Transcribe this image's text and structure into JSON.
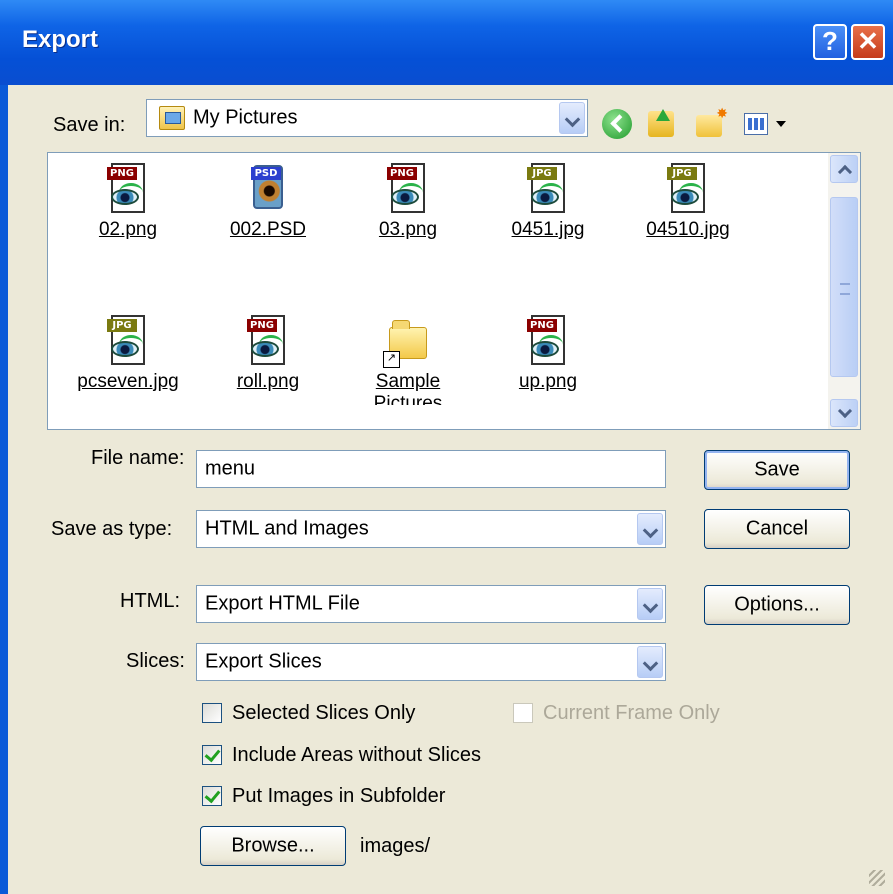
{
  "window": {
    "title": "Export",
    "help_icon": "?",
    "close_icon": "✕"
  },
  "save_in": {
    "label": "Save in:",
    "value": "My Pictures",
    "icon": "my-pictures-folder-icon"
  },
  "toolbar": {
    "icons": [
      "back-icon",
      "up-one-level-icon",
      "create-new-folder-icon",
      "views-menu-icon"
    ]
  },
  "files": [
    {
      "name": "02.png",
      "badge": "PNG",
      "type": "png"
    },
    {
      "name": "002.PSD",
      "badge": "PSD",
      "type": "psd"
    },
    {
      "name": "03.png",
      "badge": "PNG",
      "type": "png"
    },
    {
      "name": "0451.jpg",
      "badge": "JPG",
      "type": "jpg"
    },
    {
      "name": "04510.jpg",
      "badge": "JPG",
      "type": "jpg"
    },
    {
      "name": "pcseven.jpg",
      "badge": "JPG",
      "type": "jpg"
    },
    {
      "name": "roll.png",
      "badge": "PNG",
      "type": "png"
    },
    {
      "name": "Sample Pictures",
      "badge": "",
      "type": "folder-shortcut"
    },
    {
      "name": "up.png",
      "badge": "PNG",
      "type": "png"
    }
  ],
  "form": {
    "file_name_label": "File name:",
    "file_name_value": "menu",
    "save_as_type_label": "Save as type:",
    "save_as_type_value": "HTML and Images",
    "html_label": "HTML:",
    "html_value": "Export HTML File",
    "slices_label": "Slices:",
    "slices_value": "Export Slices"
  },
  "buttons": {
    "save": "Save",
    "cancel": "Cancel",
    "options": "Options...",
    "browse": "Browse..."
  },
  "checkboxes": {
    "selected_slices_only": {
      "label": "Selected Slices Only",
      "checked": false
    },
    "current_frame_only": {
      "label": "Current Frame Only",
      "checked": false,
      "disabled": true
    },
    "include_areas": {
      "label": "Include Areas without Slices",
      "checked": true
    },
    "put_images_subfolder": {
      "label": "Put Images in Subfolder",
      "checked": true
    }
  },
  "subfolder_path": "images/",
  "colors": {
    "titlebar": "#0a5ad8",
    "dialog_bg": "#ece9d8",
    "png_badge": "#8b0000",
    "jpg_badge": "#7a7a10",
    "psd_badge": "#2b3fcf"
  }
}
